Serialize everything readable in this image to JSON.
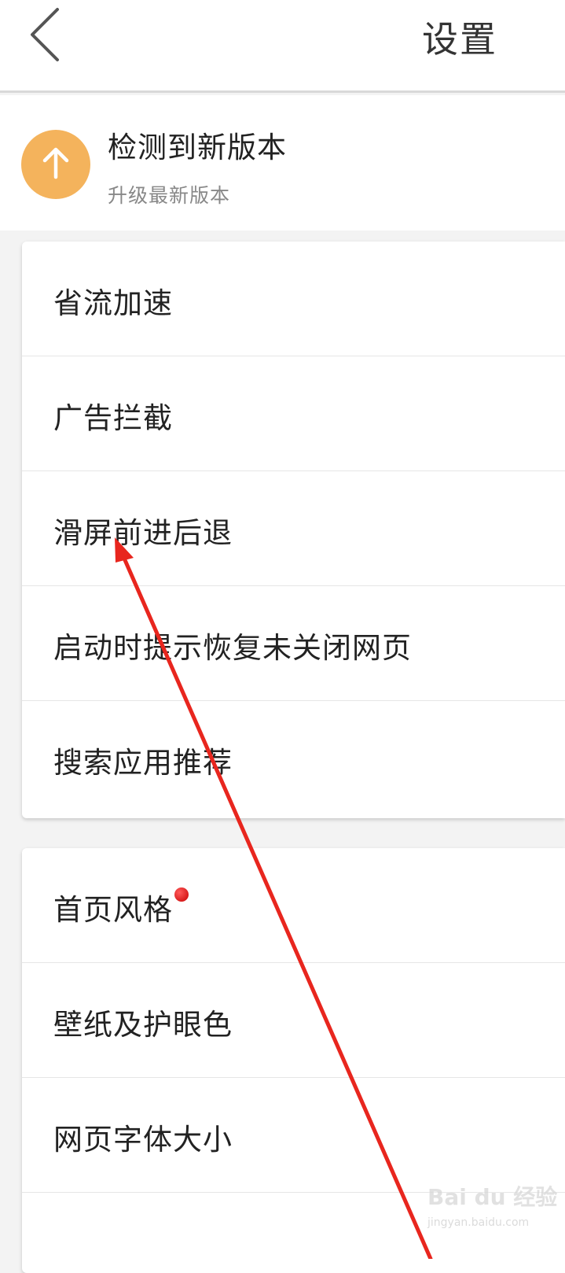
{
  "header": {
    "title": "设置",
    "back_icon": "chevron-left-icon"
  },
  "update_banner": {
    "title": "检测到新版本",
    "subtitle": "升级最新版本",
    "icon": "arrow-up-icon",
    "icon_bg_color": "#f4b35c"
  },
  "groups": [
    {
      "items": [
        {
          "label": "省流加速"
        },
        {
          "label": "广告拦截"
        },
        {
          "label": "滑屏前进后退"
        },
        {
          "label": "启动时提示恢复未关闭网页"
        },
        {
          "label": "搜索应用推荐"
        }
      ]
    },
    {
      "items": [
        {
          "label": "首页风格",
          "badge": "red-dot"
        },
        {
          "label": "壁纸及护眼色"
        },
        {
          "label": "网页字体大小"
        }
      ]
    }
  ],
  "annotation": {
    "type": "arrow",
    "color": "#e8261e",
    "target": "滑屏前进后退"
  },
  "watermark": {
    "text": "Bai du 经验",
    "url": "jingyan.baidu.com"
  }
}
